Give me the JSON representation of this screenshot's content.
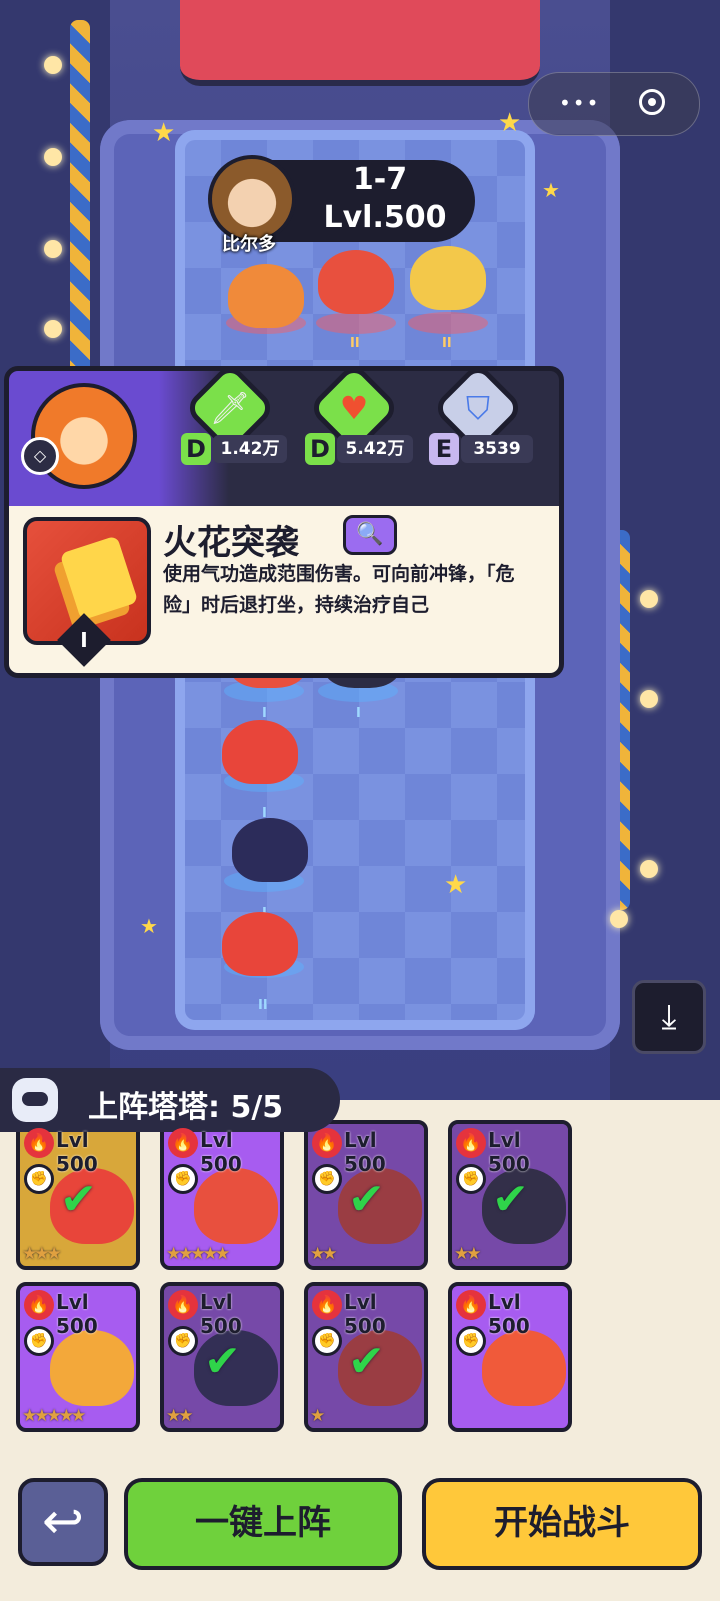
{
  "opponent": {
    "name": "比尔多",
    "stage": "1-7",
    "level": "Lvl.500"
  },
  "enemy_units": [
    {
      "rank": ""
    },
    {
      "rank": "II"
    },
    {
      "rank": "II"
    }
  ],
  "hero_panel": {
    "stats": [
      {
        "icon": "sword-icon",
        "grade": "D",
        "value": "1.42万"
      },
      {
        "icon": "heart-icon",
        "grade": "D",
        "value": "5.42万"
      },
      {
        "icon": "shield-icon",
        "grade": "E",
        "value": "3539"
      }
    ],
    "skill": {
      "name": "火花突袭",
      "tier": "I",
      "description": "使用气功造成范围伤害。可向前冲锋，「危险」时后退打坐，持续治疗自己"
    }
  },
  "ally_units": [
    {
      "rank": "I"
    },
    {
      "rank": "I"
    },
    {
      "rank": "I"
    },
    {
      "rank": "I"
    },
    {
      "rank": "II"
    }
  ],
  "team": {
    "label": "上阵塔塔: 5/5"
  },
  "roster": [
    {
      "level": "Lvl 500",
      "stars": "★★★",
      "selected": true,
      "frame": "gold"
    },
    {
      "level": "Lvl 500",
      "stars": "★★★★★",
      "selected": false,
      "frame": "purple"
    },
    {
      "level": "Lvl 500",
      "stars": "★★",
      "selected": true,
      "frame": "purple"
    },
    {
      "level": "Lvl 500",
      "stars": "★★",
      "selected": true,
      "frame": "purple"
    },
    {
      "level": "Lvl 500",
      "stars": "★★★★★",
      "selected": false,
      "frame": "purple"
    },
    {
      "level": "Lvl 500",
      "stars": "★★",
      "selected": true,
      "frame": "purple"
    },
    {
      "level": "Lvl 500",
      "stars": "★",
      "selected": true,
      "frame": "purple"
    },
    {
      "level": "Lvl 500",
      "stars": "",
      "selected": false,
      "frame": "purple"
    }
  ],
  "buttons": {
    "back": "↩",
    "auto_deploy": "一键上阵",
    "start_battle": "开始战斗"
  },
  "menu": {
    "dots": "•••"
  },
  "colors": {
    "accent_green": "#6fd13c",
    "accent_yellow": "#ffc83a",
    "panel_dark": "#1d1d2e"
  }
}
